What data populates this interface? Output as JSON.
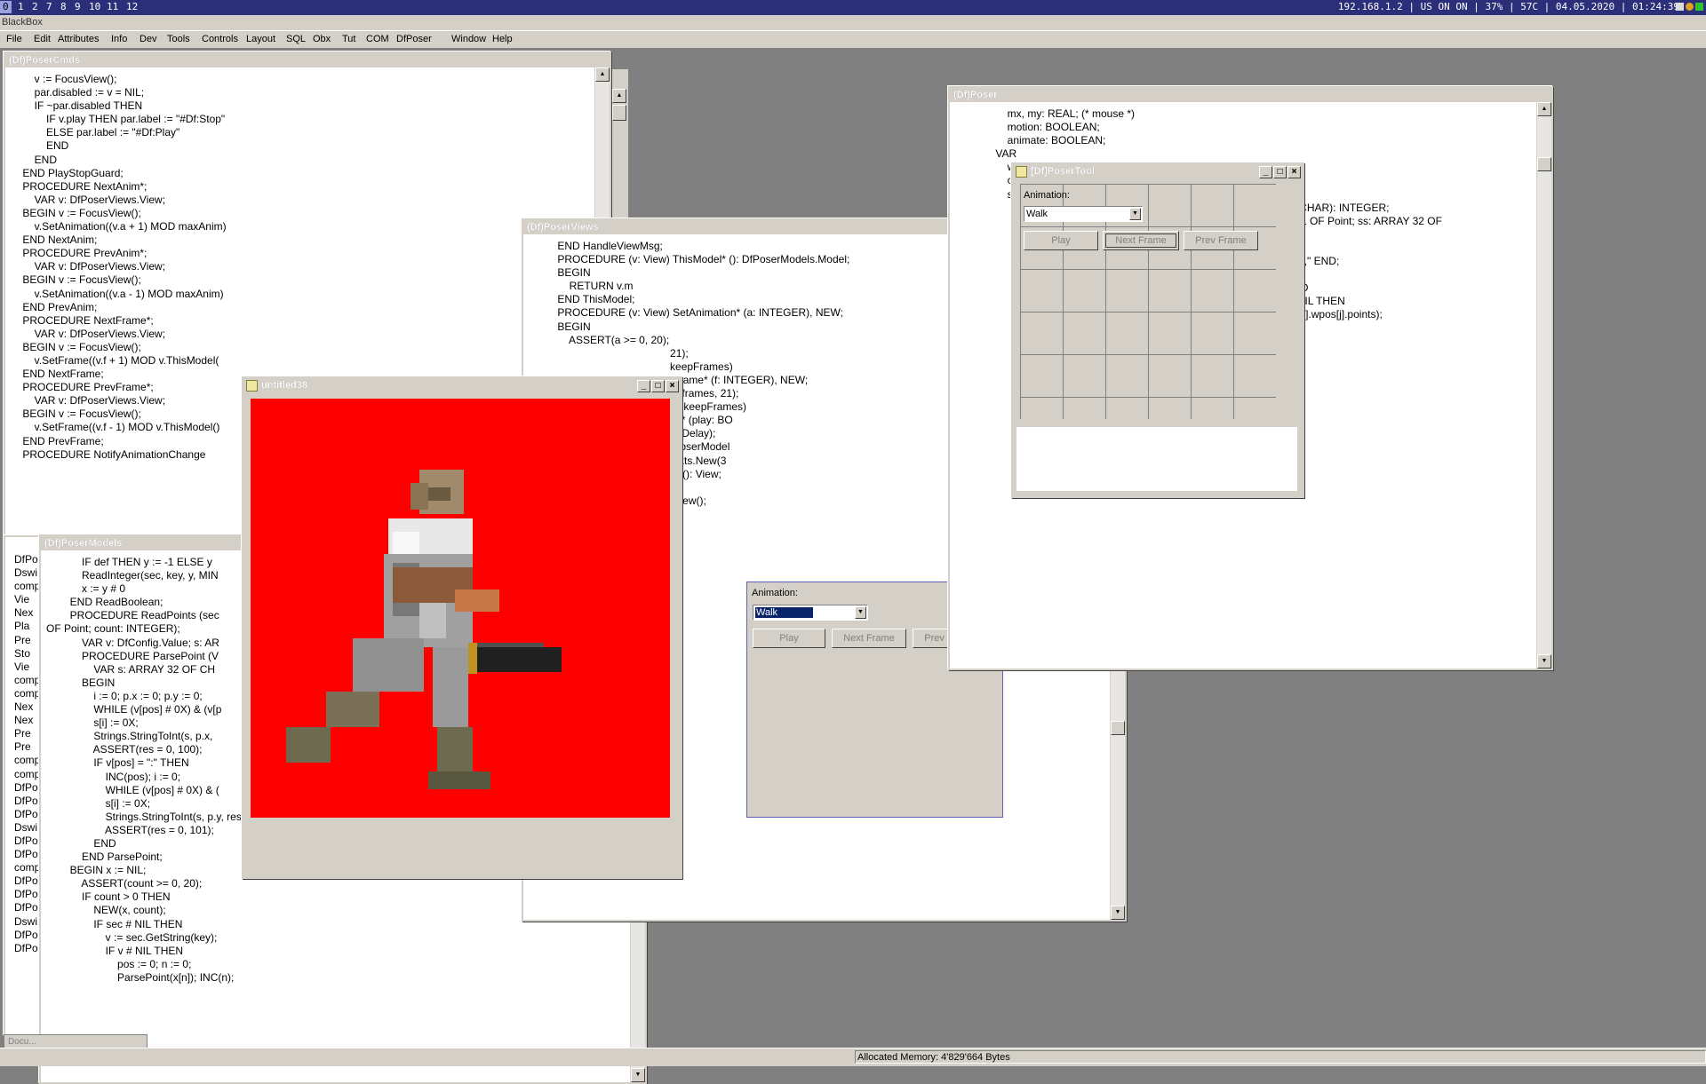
{
  "topbar": {
    "workspaces": [
      "0",
      "1",
      "2",
      "7",
      "8",
      "9",
      "10",
      "11",
      "12"
    ],
    "active_workspace": "0",
    "status_text": "192.168.1.2 | US ON ON | 37% | 57C | 04.05.2020 | 01:24:39"
  },
  "app": {
    "title": "BlackBox",
    "menu": [
      "File",
      "Edit",
      "Attributes",
      "Info",
      "Dev",
      "Tools",
      "Controls",
      "Layout",
      "SQL",
      "Obx",
      "Tut",
      "COM",
      "DfPoser",
      "Window",
      "Help"
    ]
  },
  "windows": {
    "poser_cmds": {
      "title": "(Df)PoserCmds",
      "lines": [
        "        v := FocusView();",
        "        par.disabled := v = NIL;",
        "        IF ~par.disabled THEN",
        "            IF v.play THEN par.label := \"#Df:Stop\"",
        "            ELSE par.label := \"#Df:Play\"",
        "            END",
        "        END",
        "    END PlayStopGuard;",
        "",
        "    PROCEDURE NextAnim*;",
        "        VAR v: DfPoserViews.View;",
        "    BEGIN v := FocusView();",
        "        v.SetAnimation((v.a + 1) MOD maxAnim)",
        "    END NextAnim;",
        "",
        "    PROCEDURE PrevAnim*;",
        "        VAR v: DfPoserViews.View;",
        "    BEGIN v := FocusView();",
        "        v.SetAnimation((v.a - 1) MOD maxAnim)",
        "    END PrevAnim;",
        "",
        "    PROCEDURE NextFrame*;",
        "        VAR v: DfPoserViews.View;",
        "    BEGIN v := FocusView();",
        "        v.SetFrame((v.f + 1) MOD v.ThisModel(",
        "    END NextFrame;",
        "",
        "    PROCEDURE PrevFrame*;",
        "        VAR v: DfPoserViews.View;",
        "    BEGIN v := FocusView();",
        "        v.SetFrame((v.f - 1) MOD v.ThisModel()",
        "    END PrevFrame;",
        "",
        "    PROCEDURE NotifyAnimationChange"
      ]
    },
    "browser_list": {
      "items": [
        "DfPo",
        "Dswi",
        "comp",
        "Vie",
        "Nex",
        "Pla",
        "Pre",
        "Sto",
        "Vie",
        "comp",
        "comp",
        "Nex",
        "Nex",
        "Pre",
        "Pre",
        "comp",
        "comp",
        "DfPo",
        "DfPo",
        "DfPo",
        "Dswi",
        "DfPo",
        "DfPo",
        "comp",
        "DfPo",
        "DfPo",
        "DfPo",
        "Dswi",
        "DfPo",
        "DfPo"
      ]
    },
    "poser_models": {
      "title": "(Df)PoserModels",
      "lines": [
        "            IF def THEN y := -1 ELSE y",
        "            ReadInteger(sec, key, y, MIN",
        "            x := y # 0",
        "        END ReadBoolean;",
        "",
        "        PROCEDURE ReadPoints (sec",
        "OF Point; count: INTEGER);",
        "            VAR v: DfConfig.Value; s: AR",
        "",
        "            PROCEDURE ParsePoint (V",
        "                VAR s: ARRAY 32 OF CH",
        "            BEGIN",
        "                i := 0; p.x := 0; p.y := 0;",
        "                WHILE (v[pos] # 0X) & (v[p",
        "                s[i] := 0X;",
        "                Strings.StringToInt(s, p.x,",
        "                ASSERT(res = 0, 100);",
        "                IF v[pos] = \":\" THEN",
        "                    INC(pos); i := 0;",
        "                    WHILE (v[pos] # 0X) & (",
        "                    s[i] := 0X;",
        "                    Strings.StringToInt(s, p.y, res);",
        "                    ASSERT(res = 0, 101);",
        "                END",
        "            END ParsePoint;",
        "",
        "        BEGIN x := NIL;",
        "            ASSERT(count >= 0, 20);",
        "            IF count > 0 THEN",
        "                NEW(x, count);",
        "                IF sec # NIL THEN",
        "                    v := sec.GetString(key);",
        "                    IF v # NIL THEN",
        "                        pos := 0; n := 0;",
        "                        ParsePoint(x[n]); INC(n);"
      ]
    },
    "untitled": {
      "title": "untitled38"
    },
    "poser_views": {
      "title": "(Df)PoserViews",
      "lines": [
        "    END HandleViewMsg;",
        "",
        "    PROCEDURE (v: View) ThisModel* (): DfPoserModels.Model;",
        "    BEGIN",
        "        RETURN v.m",
        "    END ThisModel;",
        "",
        "    PROCEDURE (v: View) SetAnimation* (a: INTEGER), NEW;",
        "    BEGIN",
        "        ASSERT(a >= 0, 20);",
        "                                          21);",
        "",
        "                                          keepFrames)",
        "",
        "",
        "                                          tFrame* (f: INTEGER), NEW;",
        "",
        "",
        "                                          a].frames, 21);",
        "",
        "",
        "                                          vs.keepFrames)",
        "",
        "",
        "                                          ay* (play: BO",
        "",
        "",
        "                                          neDelay);",
        "",
        "",
        "",
        "                                          fPoserModel",
        "",
        "",
        "",
        "                                          texts.New(3",
        "",
        "",
        "",
        "",
        "                                          v* (): View;",
        "",
        "    BEGIN",
        "        v := Controllers.FocusView();",
        "        IF v # NIL THEN"
      ]
    },
    "poser": {
      "title": "(Df)Poser",
      "lines": [
        "        mx, my: REAL; (* mouse *)",
        "        motion: BOOLEAN;",
        "        animate: BOOLEAN;",
        "",
        "    VAR",
        "        windo",
        "        conte",
        "        srcP",
        "",
        "                                                                                                   ORTCHAR): INTEGER;",
        "",
        "",
        "",
        "",
        "",
        "                                                                                                   RAY 1 OF Point; ss: ARRAY 32 OF",
        "",
        "",
        "",
        "",
        "",
        "",
        "",
        "",
        "",
        "                                                                                                   .x, f);",
        "                                                                                                   .y, g);",
        "",
        "                                                                                                   s$ + \",\" END;",
        "",
        "",
        "",
        "",
        "                                                                                                    DO",
        "                                                                                                   - 1 DO",
        "                                                                                                   ts # NIL THEN",
        "                                                                                                   anim[i].wpos[j].points);"
      ]
    },
    "poser_tool": {
      "title": "[Df]PoserTool",
      "animation_label": "Animation:",
      "animation_value": "Walk",
      "play_label": "Play",
      "next_frame_label": "Next Frame",
      "prev_frame_label": "Prev Frame"
    },
    "embedded_panel": {
      "animation_label": "Animation:",
      "animation_value": "Walk",
      "play_label": "Play",
      "next_frame_label": "Next Frame",
      "prev_frame_label": "Prev Frame"
    },
    "documents_tab": "Docu..."
  },
  "statusbar": {
    "memory": "Allocated Memory: 4'829'664 Bytes"
  },
  "colors": {
    "topbar": "#2b2f7a",
    "sprite_background": "#ff0000",
    "chrome": "#d4d0c8"
  }
}
